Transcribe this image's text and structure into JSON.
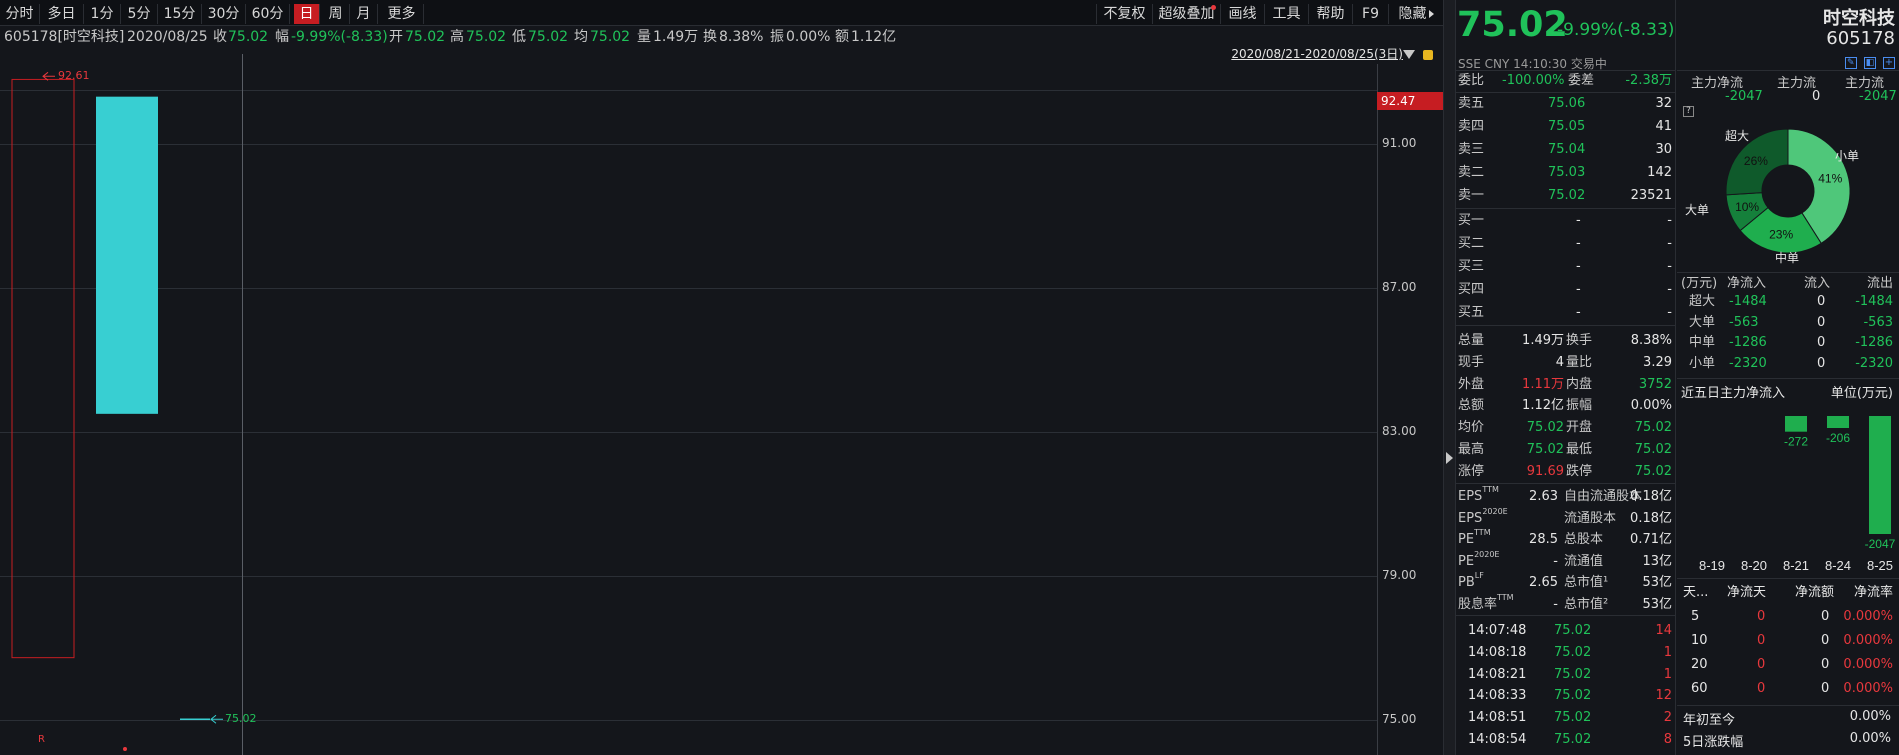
{
  "toolbar": {
    "periods": [
      "分时",
      "多日",
      "1分",
      "5分",
      "15分",
      "30分",
      "60分",
      "日",
      "周",
      "月",
      "更多"
    ],
    "active": "日",
    "right_items": [
      "不复权",
      "超级叠加",
      "画线",
      "工具",
      "帮助",
      "F9",
      "隐藏"
    ]
  },
  "infobar": {
    "stock": "605178[时空科技]",
    "date": "2020/08/25",
    "close_label": "收",
    "close": "75.02",
    "amp_label": "幅",
    "amp": "-9.99%(-8.33)",
    "open_label": "开",
    "open": "75.02",
    "high_label": "高",
    "high": "75.02",
    "low_label": "低",
    "low": "75.02",
    "avg_label": "均",
    "avg": "75.02",
    "vol_label": "量",
    "vol": "1.49万",
    "turn_label": "换",
    "turn": "8.38%",
    "zf_label": "振",
    "zf": "0.00%",
    "amt_label": "额",
    "amt": "1.12亿"
  },
  "date_range": "2020/08/21-2020/08/25(3日)",
  "chart_data": {
    "type": "candlestick",
    "yticks": [
      "91.00",
      "87.00",
      "83.00",
      "79.00",
      "75.00"
    ],
    "ylim": [
      75.0,
      93.0
    ],
    "current_price_tag": "92.47",
    "high_marker": "92.61",
    "low_marker": "75.02",
    "candles": [
      {
        "open": 92.47,
        "close": 76.7,
        "high": 92.61,
        "low": 76.7,
        "style": "hollow-red"
      },
      {
        "open": 92.0,
        "close": 83.35,
        "high": 92.0,
        "low": 83.35,
        "style": "cyan"
      },
      {
        "open": 75.02,
        "close": 75.02,
        "high": 75.02,
        "low": 75.02,
        "style": "flat"
      }
    ],
    "volume_marker": "R"
  },
  "quote": {
    "price": "75.02",
    "change": "-9.99%(-8.33)",
    "name": "时空科技",
    "code": "605178",
    "exchange": "SSE",
    "currency": "CNY",
    "time": "14:10:30",
    "status": "交易中"
  },
  "order": {
    "ratio_label": "委比",
    "ratio": "-100.00%",
    "diff_label": "委差",
    "diff": "-2.38万",
    "sells": [
      {
        "label": "卖五",
        "price": "75.06",
        "vol": "32"
      },
      {
        "label": "卖四",
        "price": "75.05",
        "vol": "41"
      },
      {
        "label": "卖三",
        "price": "75.04",
        "vol": "30"
      },
      {
        "label": "卖二",
        "price": "75.03",
        "vol": "142"
      },
      {
        "label": "卖一",
        "price": "75.02",
        "vol": "23521"
      }
    ],
    "buys": [
      {
        "label": "买一",
        "price": "-",
        "vol": "-"
      },
      {
        "label": "买二",
        "price": "-",
        "vol": "-"
      },
      {
        "label": "买三",
        "price": "-",
        "vol": "-"
      },
      {
        "label": "买四",
        "price": "-",
        "vol": "-"
      },
      {
        "label": "买五",
        "price": "-",
        "vol": "-"
      }
    ]
  },
  "stats": [
    {
      "l1": "总量",
      "v1": "1.49万",
      "c1": "wh",
      "l2": "换手",
      "v2": "8.38%",
      "c2": "wh"
    },
    {
      "l1": "现手",
      "v1": "4",
      "c1": "wh",
      "l2": "量比",
      "v2": "3.29",
      "c2": "wh"
    },
    {
      "l1": "外盘",
      "v1": "1.11万",
      "c1": "up",
      "l2": "内盘",
      "v2": "3752",
      "c2": "dn"
    },
    {
      "l1": "总额",
      "v1": "1.12亿",
      "c1": "wh",
      "l2": "振幅",
      "v2": "0.00%",
      "c2": "wh"
    },
    {
      "l1": "均价",
      "v1": "75.02",
      "c1": "dn",
      "l2": "开盘",
      "v2": "75.02",
      "c2": "dn"
    },
    {
      "l1": "最高",
      "v1": "75.02",
      "c1": "dn",
      "l2": "最低",
      "v2": "75.02",
      "c2": "dn"
    },
    {
      "l1": "涨停",
      "v1": "91.69",
      "c1": "up",
      "l2": "跌停",
      "v2": "75.02",
      "c2": "dn"
    }
  ],
  "fund": [
    {
      "l1": "EPS",
      "s1": "TTM",
      "v1": "2.63",
      "l2": "自由流通股本",
      "v2": "0.18亿"
    },
    {
      "l1": "EPS",
      "s1": "2020E",
      "v1": "",
      "l2": "流通股本",
      "v2": "0.18亿"
    },
    {
      "l1": "PE",
      "s1": "TTM",
      "v1": "28.5",
      "l2": "总股本",
      "v2": "0.71亿"
    },
    {
      "l1": "PE",
      "s1": "2020E",
      "v1": "-",
      "l2": "流通值",
      "v2": "13亿"
    },
    {
      "l1": "PB",
      "s1": "LF",
      "v1": "2.65",
      "l2": "总市值¹",
      "v2": "53亿"
    },
    {
      "l1": "股息率",
      "s1": "TTM",
      "v1": "-",
      "l2": "总市值²",
      "v2": "53亿"
    }
  ],
  "ticks": [
    {
      "time": "14:07:48",
      "price": "75.02",
      "vol": "14"
    },
    {
      "time": "14:08:18",
      "price": "75.02",
      "vol": "1"
    },
    {
      "time": "14:08:21",
      "price": "75.02",
      "vol": "1"
    },
    {
      "time": "14:08:33",
      "price": "75.02",
      "vol": "12"
    },
    {
      "time": "14:08:51",
      "price": "75.02",
      "vol": "2"
    },
    {
      "time": "14:08:54",
      "price": "75.02",
      "vol": "8"
    }
  ],
  "flow": {
    "headers": [
      "主力净流",
      "主力流",
      "主力流"
    ],
    "values": [
      "-2047",
      "0",
      "-2047"
    ],
    "help": "?",
    "donut": [
      {
        "name": "小单",
        "pct": 41,
        "label": "41%",
        "color": "#4fc77a"
      },
      {
        "name": "中单",
        "pct": 23,
        "label": "23%",
        "color": "#1fae4e"
      },
      {
        "name": "大单",
        "pct": 10,
        "label": "10%",
        "color": "#15803b"
      },
      {
        "name": "超大",
        "pct": 26,
        "label": "26%",
        "color": "#0f5a2b"
      }
    ],
    "table_headers": [
      "(万元)",
      "净流入",
      "流入",
      "流出"
    ],
    "table": [
      {
        "name": "超大",
        "net": "-1484",
        "in": "0",
        "out": "-1484"
      },
      {
        "name": "大单",
        "net": "-563",
        "in": "0",
        "out": "-563"
      },
      {
        "name": "中单",
        "net": "-1286",
        "in": "0",
        "out": "-1286"
      },
      {
        "name": "小单",
        "net": "-2320",
        "in": "0",
        "out": "-2320"
      }
    ],
    "five_title": "近五日主力净流入",
    "five_unit": "单位(万元)",
    "five_days": [
      {
        "date": "8-19",
        "value": 0,
        "label": ""
      },
      {
        "date": "8-20",
        "value": 0,
        "label": ""
      },
      {
        "date": "8-21",
        "value": -272,
        "label": "-272"
      },
      {
        "date": "8-24",
        "value": -206,
        "label": "-206"
      },
      {
        "date": "8-25",
        "value": -2047,
        "label": "-2047"
      }
    ],
    "period_headers": [
      "天...",
      "净流天",
      "净流额",
      "净流率"
    ],
    "periods": [
      {
        "d": "5",
        "days": "0",
        "amt": "0",
        "rate": "0.000%"
      },
      {
        "d": "10",
        "days": "0",
        "amt": "0",
        "rate": "0.000%"
      },
      {
        "d": "20",
        "days": "0",
        "amt": "0",
        "rate": "0.000%"
      },
      {
        "d": "60",
        "days": "0",
        "amt": "0",
        "rate": "0.000%"
      }
    ],
    "ytd_label": "年初至今",
    "ytd": "0.00%",
    "five_chg_label": "5日涨跌幅",
    "five_chg": "0.00%"
  }
}
